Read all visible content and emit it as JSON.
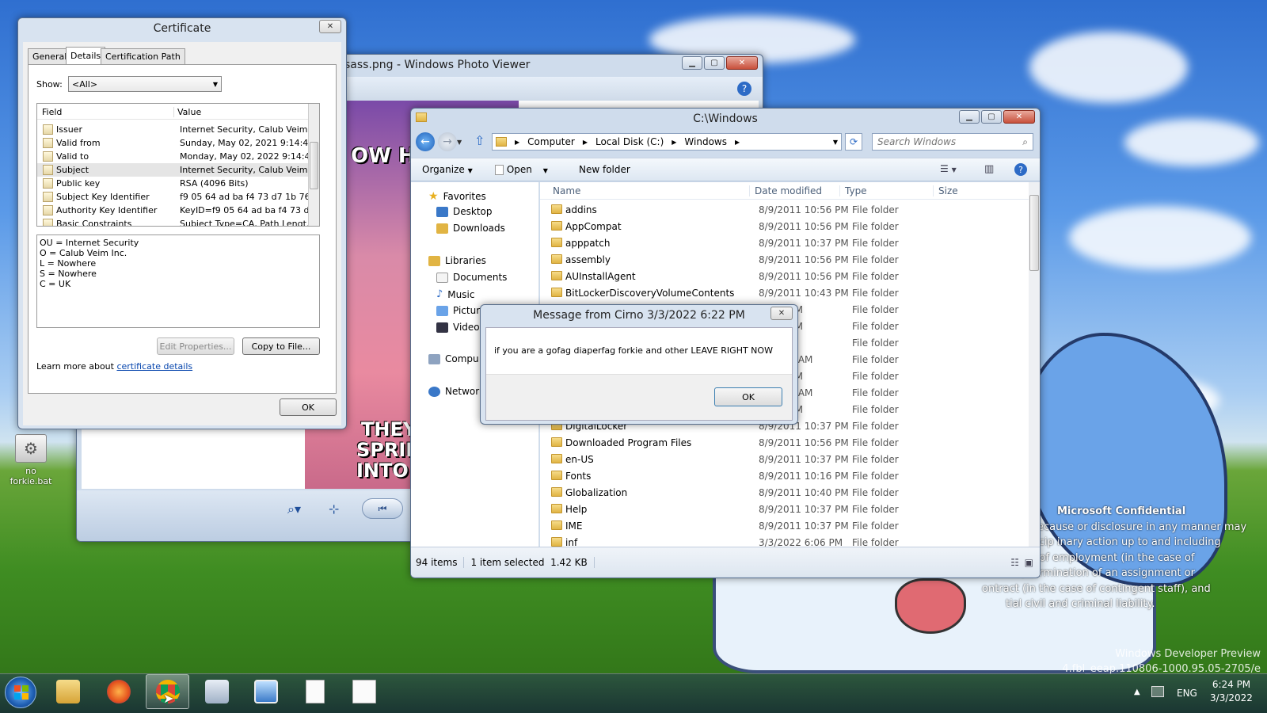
{
  "desktop": {
    "icon_label": "no forkie.bat",
    "confidential_title": "Microsoft Confidential",
    "confidential_lines": [
      "ecause or disclosure in any manner may",
      "scip inary action up to and including",
      "n of employment (in the case of",
      ") termination of an assignment or",
      "ontract (in the case of contingent staff), and",
      "tial civil and criminal liability."
    ],
    "watermark_line1": "Windows Developer Preview",
    "watermark_line2": "4.fbl_eeap.110806-1000.95.05-2705/e"
  },
  "certificate": {
    "title": "Certificate",
    "tabs": [
      "General",
      "Details",
      "Certification Path"
    ],
    "show_label": "Show:",
    "show_value": "<All>",
    "col_field": "Field",
    "col_value": "Value",
    "rows": [
      {
        "field": "Issuer",
        "value": "Internet Security, Calub Veim ..."
      },
      {
        "field": "Valid from",
        "value": "Sunday, May 02, 2021 9:14:4..."
      },
      {
        "field": "Valid to",
        "value": "Monday, May 02, 2022 9:14:4..."
      },
      {
        "field": "Subject",
        "value": "Internet Security, Calub Veim ..."
      },
      {
        "field": "Public key",
        "value": "RSA (4096 Bits)"
      },
      {
        "field": "Subject Key Identifier",
        "value": "f9 05 64 ad ba f4 73 d7 1b 76 ..."
      },
      {
        "field": "Authority Key Identifier",
        "value": "KeyID=f9 05 64 ad ba f4 73 d..."
      },
      {
        "field": "Basic Constraints",
        "value": "Subject Type=CA, Path Lengt..."
      }
    ],
    "detail_lines": [
      "OU = Internet Security",
      "O = Calub Veim Inc.",
      "L = Nowhere",
      "S = Nowhere",
      "C = UK"
    ],
    "edit_properties": "Edit Properties...",
    "copy_to_file": "Copy to File...",
    "learn_more": "Learn more about",
    "learn_link": "certificate details",
    "ok": "OK"
  },
  "photo_viewer": {
    "title": "sass.png - Windows Photo Viewer",
    "image_text_top": "OW HI",
    "image_text_bottom1": "THEY",
    "image_text_bottom2": "SPRINK",
    "image_text_bottom3": "INTO PO"
  },
  "explorer": {
    "title": "C:\\Windows",
    "breadcrumb": [
      "Computer",
      "Local Disk (C:)",
      "Windows"
    ],
    "search_placeholder": "Search Windows",
    "toolbar": {
      "organize": "Organize",
      "open": "Open",
      "new_folder": "New folder"
    },
    "nav": {
      "favorites": "Favorites",
      "desktop": "Desktop",
      "downloads": "Downloads",
      "libraries": "Libraries",
      "documents": "Documents",
      "music": "Music",
      "pictures": "Pictur",
      "videos": "Video",
      "computer": "Compu",
      "network": "Network"
    },
    "columns": {
      "name": "Name",
      "date": "Date modified",
      "type": "Type",
      "size": "Size"
    },
    "rows": [
      {
        "name": "addins",
        "date": "8/9/2011 10:56 PM",
        "type": "File folder"
      },
      {
        "name": "AppCompat",
        "date": "8/9/2011 10:56 PM",
        "type": "File folder"
      },
      {
        "name": "apppatch",
        "date": "8/9/2011 10:37 PM",
        "type": "File folder"
      },
      {
        "name": "assembly",
        "date": "8/9/2011 10:56 PM",
        "type": "File folder"
      },
      {
        "name": "AUInstallAgent",
        "date": "8/9/2011 10:56 PM",
        "type": "File folder"
      },
      {
        "name": "BitLockerDiscoveryVolumeContents",
        "date": "8/9/2011 10:43 PM",
        "type": "File folder"
      },
      {
        "name": "",
        "date": "10:56 PM",
        "type": "File folder"
      },
      {
        "name": "",
        "date": "10:56 PM",
        "type": "File folder"
      },
      {
        "name": "",
        "date": "5:01 PM",
        "type": "File folder"
      },
      {
        "name": "",
        "date": "21 6:40 AM",
        "type": "File folder"
      },
      {
        "name": "",
        "date": "10:56 PM",
        "type": "File folder"
      },
      {
        "name": "",
        "date": "21 6:43 AM",
        "type": "File folder"
      },
      {
        "name": "",
        "date": "10:56 PM",
        "type": "File folder"
      },
      {
        "name": "DigitalLocker",
        "date": "8/9/2011 10:37 PM",
        "type": "File folder"
      },
      {
        "name": "Downloaded Program Files",
        "date": "8/9/2011 10:56 PM",
        "type": "File folder"
      },
      {
        "name": "en-US",
        "date": "8/9/2011 10:37 PM",
        "type": "File folder"
      },
      {
        "name": "Fonts",
        "date": "8/9/2011 10:16 PM",
        "type": "File folder"
      },
      {
        "name": "Globalization",
        "date": "8/9/2011 10:40 PM",
        "type": "File folder"
      },
      {
        "name": "Help",
        "date": "8/9/2011 10:37 PM",
        "type": "File folder"
      },
      {
        "name": "IME",
        "date": "8/9/2011 10:37 PM",
        "type": "File folder"
      },
      {
        "name": "inf",
        "date": "3/3/2022 6:06 PM",
        "type": "File folder"
      }
    ],
    "status_items": "94 items",
    "status_selected": "1 item selected  1.42 KB"
  },
  "message": {
    "title": "Message from Cirno 3/3/2022 6:22 PM",
    "body": "if you are a gofag diaperfag forkie and other LEAVE RIGHT NOW",
    "ok": "OK"
  },
  "taskbar": {
    "lang": "ENG",
    "time": "6:24 PM",
    "date": "3/3/2022"
  }
}
